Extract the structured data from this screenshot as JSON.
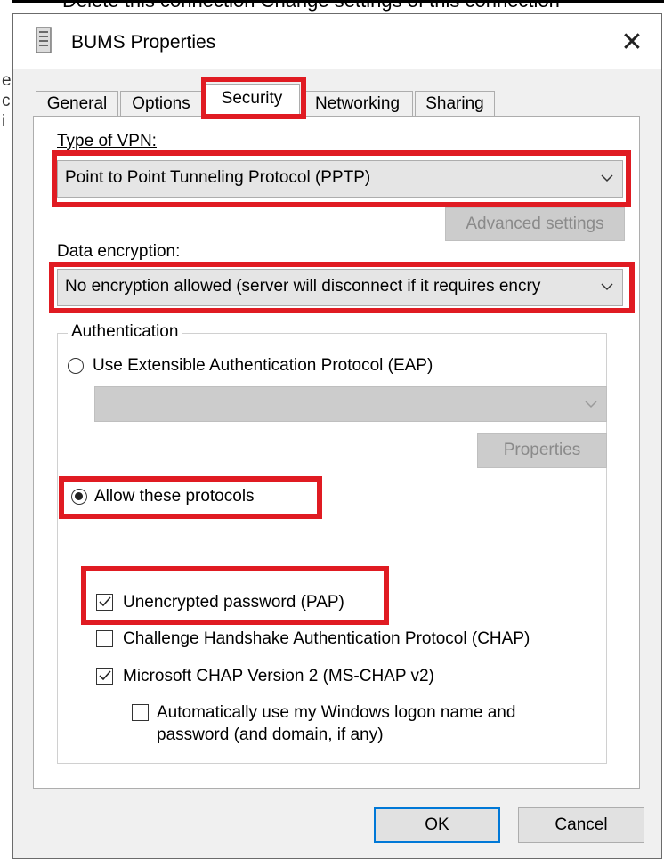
{
  "background": {
    "header_text": "Delete this connection     Change settings of this connection",
    "left_letters": [
      "e",
      "c",
      "i"
    ]
  },
  "dialog": {
    "title": "BUMS Properties",
    "close_symbol": "✕"
  },
  "tabs": [
    {
      "label": "General",
      "active": false
    },
    {
      "label": "Options",
      "active": false
    },
    {
      "label": "Security",
      "active": true
    },
    {
      "label": "Networking",
      "active": false
    },
    {
      "label": "Sharing",
      "active": false
    }
  ],
  "security": {
    "vpn_type_label": "Type of VPN:",
    "vpn_type_value": "Point to Point Tunneling Protocol (PPTP)",
    "advanced_settings_label": "Advanced settings",
    "data_encryption_label": "Data encryption:",
    "data_encryption_value": "No encryption allowed (server will disconnect if it requires encry",
    "authentication": {
      "group_label": "Authentication",
      "eap_option_label": "Use Extensible Authentication Protocol (EAP)",
      "eap_selected": false,
      "eap_combo_value": "",
      "properties_label": "Properties",
      "allow_protocols_label": "Allow these protocols",
      "allow_protocols_selected": true,
      "protocols": [
        {
          "label": "Unencrypted password (PAP)",
          "checked": true
        },
        {
          "label": "Challenge Handshake Authentication Protocol (CHAP)",
          "checked": false
        },
        {
          "label": "Microsoft CHAP Version 2 (MS-CHAP v2)",
          "checked": true
        }
      ],
      "auto_logon_label_line1": "Automatically use my Windows logon name and",
      "auto_logon_label_line2": "password (and domain, if any)",
      "auto_logon_checked": false
    }
  },
  "buttons": {
    "ok_label": "OK",
    "cancel_label": "Cancel"
  },
  "colors": {
    "highlight": "#e01b22",
    "accent": "#0078d7",
    "dialog_bg": "#f0f0f0"
  },
  "icons": {
    "title_icon": "network-connection-icon",
    "chevron": "⌵",
    "check": "✓"
  }
}
